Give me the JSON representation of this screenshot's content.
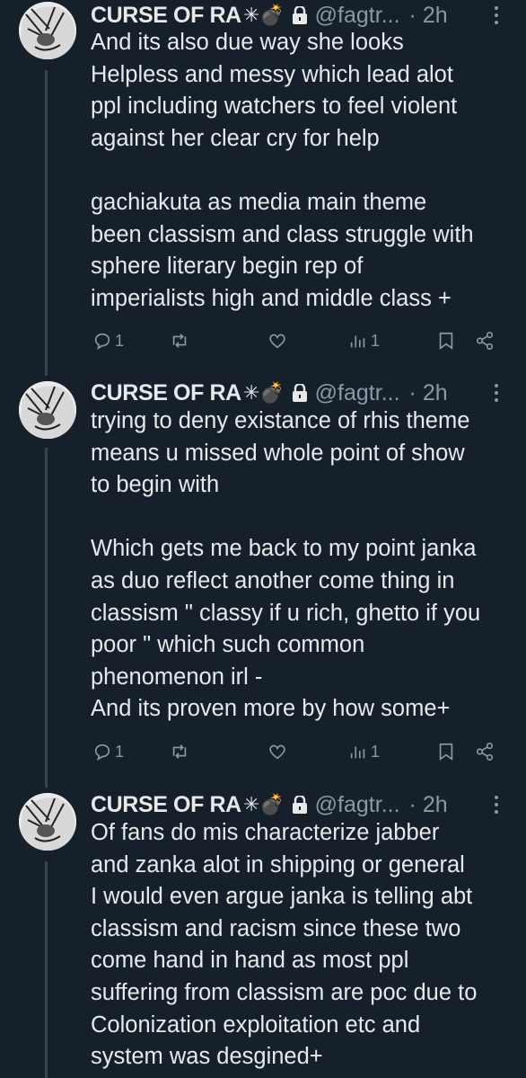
{
  "colors": {
    "background": "#15202b",
    "text": "#e7e9ea",
    "muted": "#8b98a5",
    "thread_line": "#38444d"
  },
  "tweets": [
    {
      "name": "CURSE OF RA",
      "emojis": "✳💣",
      "handle": "@fagtr...",
      "time": "· 2h",
      "text": "And its also due way she looks\nHelpless and messy which lead alot\nppl including watchers to feel violent\nagainst her clear cry for help\n\ngachiakuta as media main theme\nbeen classism and class struggle with\nsphere literary begin rep of\nimperialists high and middle class +",
      "actions": {
        "replies": "1",
        "retweets": "",
        "likes": "",
        "views": "1"
      },
      "icons": [
        "reply-icon",
        "retweet-icon",
        "like-icon",
        "views-icon",
        "bookmark-icon",
        "share-icon"
      ]
    },
    {
      "name": "CURSE OF RA",
      "emojis": "✳💣",
      "handle": "@fagtr...",
      "time": "· 2h",
      "text": "trying to deny existance of rhis theme\nmeans u missed whole point of show\nto begin with\n\nWhich gets me back to my point janka\nas duo reflect another come thing in\nclassism \" classy if u rich, ghetto if you\npoor \" which such common\nphenomenon irl -\nAnd its proven more by how some+",
      "actions": {
        "replies": "1",
        "retweets": "",
        "likes": "",
        "views": "1"
      },
      "icons": [
        "reply-icon",
        "retweet-icon",
        "like-icon",
        "views-icon",
        "bookmark-icon",
        "share-icon"
      ]
    },
    {
      "name": "CURSE OF RA",
      "emojis": "✳💣",
      "handle": "@fagtr...",
      "time": "· 2h",
      "text": "Of fans do mis characterize jabber\nand zanka alot in shipping or general\nI would even argue janka is telling abt\nclassism and racism since these two\ncome hand in hand as most ppl\nsuffering from classism are poc due to\nColonization exploitation etc and\nsystem was desgined+"
    }
  ]
}
